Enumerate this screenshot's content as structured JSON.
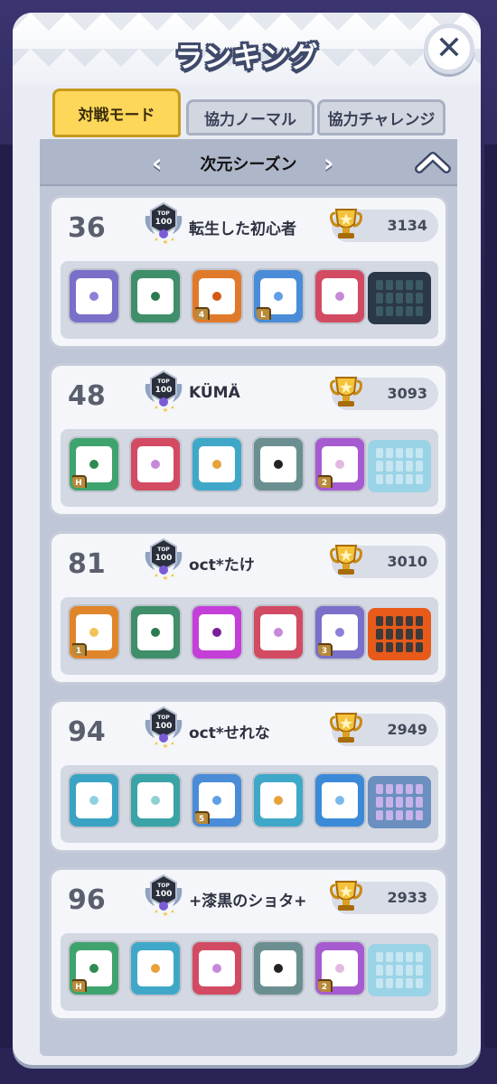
{
  "title": "ランキング",
  "close_symbol": "✕",
  "tabs": [
    {
      "label": "対戦モード",
      "active": true
    },
    {
      "label": "協力ノーマル",
      "active": false
    },
    {
      "label": "協力チャレンジ",
      "active": false
    }
  ],
  "season": {
    "name": "次元シーズン",
    "prev": "‹",
    "next": "›"
  },
  "ranks": [
    {
      "rank": "36",
      "name": "転生した初心者",
      "trophy": "3134",
      "dice": [
        {
          "color": "#7a6fc9",
          "dot": "#8d80d8",
          "level": ""
        },
        {
          "color": "#3e8f6a",
          "dot": "#2e7a4f",
          "level": ""
        },
        {
          "color": "#e07a2a",
          "dot": "#d15a15",
          "level": "4"
        },
        {
          "color": "#4a8cd8",
          "dot": "#5e9fe6",
          "level": "L"
        },
        {
          "color": "#d24b63",
          "dot": "#c58ad8",
          "level": ""
        }
      ],
      "board": {
        "frame": "#2a3848",
        "cell": "#3c5a63"
      }
    },
    {
      "rank": "48",
      "name": "KÜMÄ",
      "trophy": "3093",
      "dice": [
        {
          "color": "#3fa36e",
          "dot": "#2e8a52",
          "level": "H"
        },
        {
          "color": "#d24b63",
          "dot": "#c58ad8",
          "level": ""
        },
        {
          "color": "#3fa8c9",
          "dot": "#e8a23a",
          "level": ""
        },
        {
          "color": "#6b8f91",
          "dot": "#222222",
          "level": ""
        },
        {
          "color": "#a75bd0",
          "dot": "#e2b8e0",
          "level": "2"
        }
      ],
      "board": {
        "frame": "#9bd3e6",
        "cell": "#c6e6f2"
      }
    },
    {
      "rank": "81",
      "name": "oct*たけ",
      "trophy": "3010",
      "dice": [
        {
          "color": "#e0852a",
          "dot": "#f2c35a",
          "level": "1"
        },
        {
          "color": "#3e8f6a",
          "dot": "#2e7a4f",
          "level": ""
        },
        {
          "color": "#c43fd8",
          "dot": "#7a1f9a",
          "level": ""
        },
        {
          "color": "#d24b63",
          "dot": "#c58ad8",
          "level": ""
        },
        {
          "color": "#7a6fc9",
          "dot": "#8d80d8",
          "level": "3"
        }
      ],
      "board": {
        "frame": "#e85a1a",
        "cell": "#3c3a3a"
      }
    },
    {
      "rank": "94",
      "name": "oct*せれな",
      "trophy": "2949",
      "dice": [
        {
          "color": "#3aa3c3",
          "dot": "#8fd1e3",
          "level": ""
        },
        {
          "color": "#3aa3a6",
          "dot": "#8fd1d3",
          "level": ""
        },
        {
          "color": "#4a8cd8",
          "dot": "#5e9fe6",
          "level": "5"
        },
        {
          "color": "#3fa8c9",
          "dot": "#e8a23a",
          "level": ""
        },
        {
          "color": "#3a8ad8",
          "dot": "#7ab9ec",
          "level": ""
        }
      ],
      "board": {
        "frame": "#6b8fbf",
        "cell": "#c7b2ea"
      }
    },
    {
      "rank": "96",
      "name": "+漆黒のショタ+",
      "trophy": "2933",
      "dice": [
        {
          "color": "#3fa36e",
          "dot": "#2e8a52",
          "level": "H"
        },
        {
          "color": "#3fa8c9",
          "dot": "#e8a23a",
          "level": ""
        },
        {
          "color": "#d24b63",
          "dot": "#c58ad8",
          "level": ""
        },
        {
          "color": "#6b8f91",
          "dot": "#222222",
          "level": ""
        },
        {
          "color": "#a75bd0",
          "dot": "#e2b8e0",
          "level": "2"
        }
      ],
      "board": {
        "frame": "#9bd3e6",
        "cell": "#c6e6f2"
      }
    }
  ]
}
